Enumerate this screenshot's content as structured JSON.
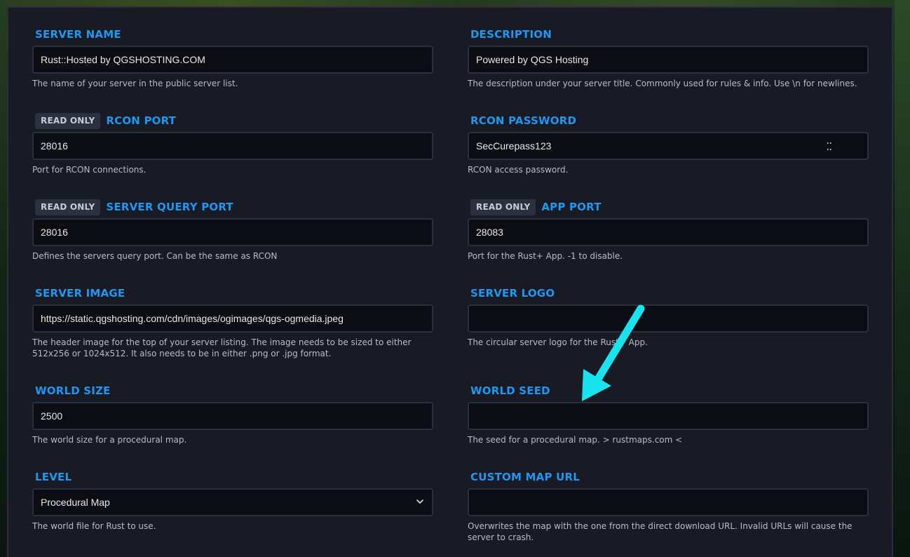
{
  "read_only_badge": "READ ONLY",
  "left": [
    {
      "key": "server_name",
      "label": "SERVER NAME",
      "value": "Rust::Hosted by QGSHOSTING.COM",
      "help": "The name of your server in the public server list.",
      "read_only": false
    },
    {
      "key": "rcon_port",
      "label": "RCON PORT",
      "value": "28016",
      "help": "Port for RCON connections.",
      "read_only": true
    },
    {
      "key": "server_query_port",
      "label": "SERVER QUERY PORT",
      "value": "28016",
      "help": "Defines the servers query port. Can be the same as RCON",
      "read_only": true
    },
    {
      "key": "server_image",
      "label": "SERVER IMAGE",
      "value": "https://static.qgshosting.com/cdn/images/ogimages/qgs-ogmedia.jpeg",
      "help": "The header image for the top of your server listing. The image needs to be sized to either 512x256 or 1024x512. It also needs to be in either .png or .jpg format.",
      "read_only": false
    },
    {
      "key": "world_size",
      "label": "WORLD SIZE",
      "value": "2500",
      "help": "The world size for a procedural map.",
      "read_only": false
    },
    {
      "key": "level",
      "label": "LEVEL",
      "value": "Procedural Map",
      "help": "The world file for Rust to use.",
      "read_only": false,
      "type": "select"
    }
  ],
  "right": [
    {
      "key": "description",
      "label": "DESCRIPTION",
      "value": "Powered by QGS Hosting",
      "help": "The description under your server title. Commonly used for rules & info. Use \\n for newlines.",
      "read_only": false
    },
    {
      "key": "rcon_password",
      "label": "RCON PASSWORD",
      "value": "SecCurepass123",
      "help": "RCON access password.",
      "read_only": false,
      "type": "password"
    },
    {
      "key": "app_port",
      "label": "APP PORT",
      "value": "28083",
      "help": "Port for the Rust+ App. -1 to disable.",
      "read_only": true
    },
    {
      "key": "server_logo",
      "label": "SERVER LOGO",
      "value": "",
      "help": "The circular server logo for the Rust+ App.",
      "read_only": false
    },
    {
      "key": "world_seed",
      "label": "WORLD SEED",
      "value": "",
      "help": "The seed for a procedural map. > rustmaps.com <",
      "read_only": false
    },
    {
      "key": "custom_map_url",
      "label": "CUSTOM MAP URL",
      "value": "",
      "help": "Overwrites the map with the one from the direct download URL. Invalid URLs will cause the server to crash.",
      "read_only": false
    }
  ],
  "colors": {
    "label_blue": "#1e98f3",
    "panel_bg": "#181a24",
    "input_bg": "#0c0d12",
    "annotation_arrow": "#19e3ee"
  },
  "icons": {
    "select": "chevron-down-icon",
    "password": "password-toggle-icon",
    "annotation": "arrow-annotation-icon"
  }
}
